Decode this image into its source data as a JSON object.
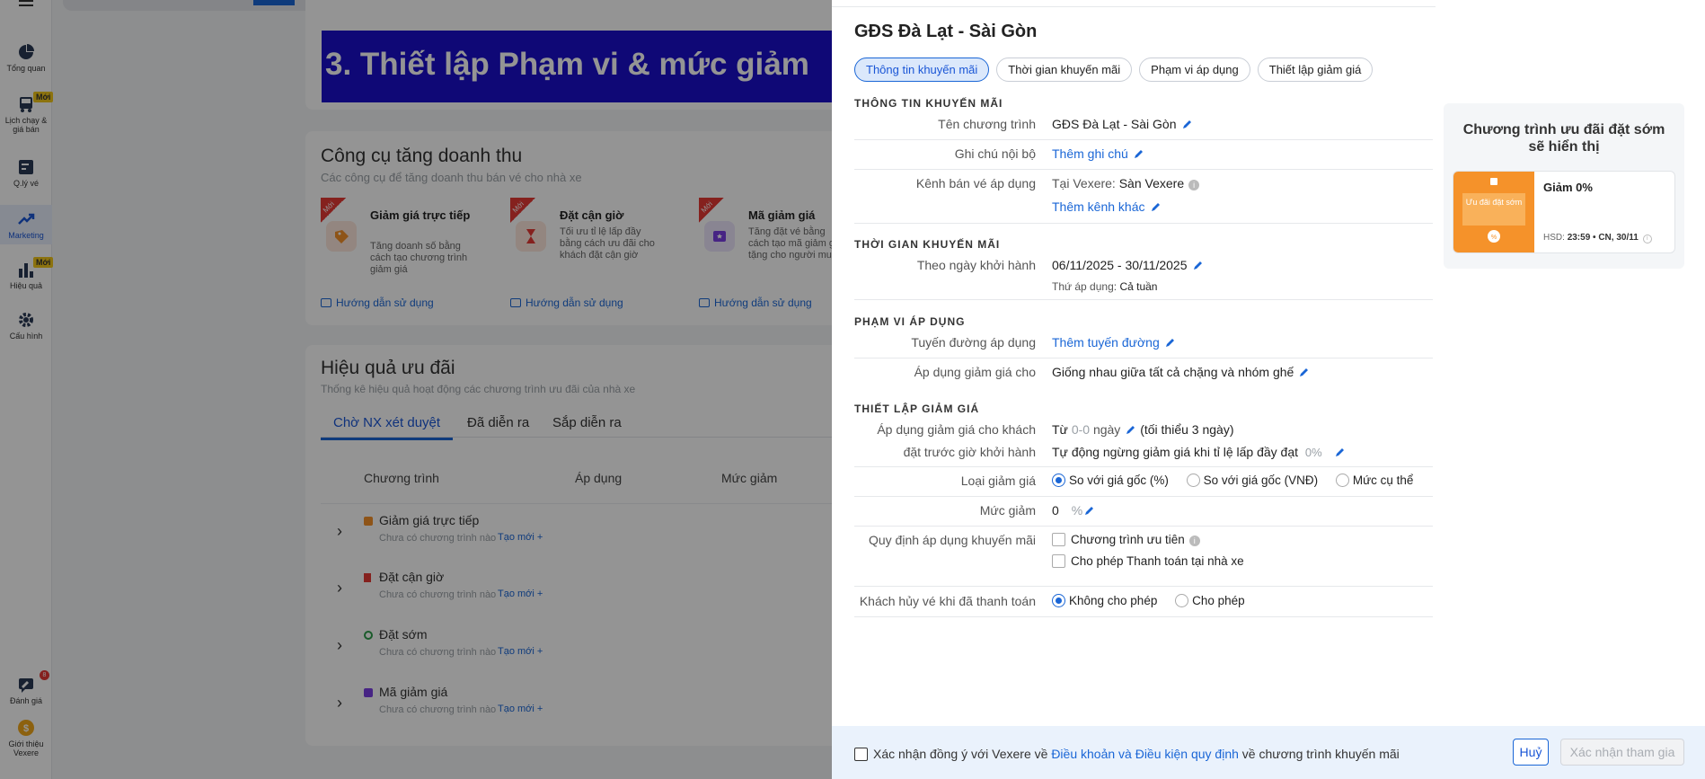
{
  "sidebar": {
    "items": [
      {
        "label": "Tổng quan",
        "icon": "pie-chart-icon"
      },
      {
        "label": "Lịch chạy & giá bán",
        "icon": "bus-icon",
        "badge": "Mới"
      },
      {
        "label": "Q.lý vé",
        "icon": "ticket-list-icon"
      },
      {
        "label": "Marketing",
        "icon": "trend-icon",
        "active": true
      },
      {
        "label": "Hiệu quả",
        "icon": "bar-chart-icon",
        "badge": "Mới"
      },
      {
        "label": "Cấu hình",
        "icon": "gear-icon"
      },
      {
        "label": "Đánh giá",
        "icon": "review-icon",
        "count": "8"
      },
      {
        "label": "Giới thiệu Vexere",
        "icon": "coin-icon"
      }
    ]
  },
  "banner": {
    "text": "3. Thiết lập Phạm vi & mức giảm"
  },
  "revenue_tools": {
    "title": "Công cụ tăng doanh thu",
    "subtitle": "Các công cụ để tăng doanh thu bán vé cho nhà xe",
    "ribbon": "Mới",
    "guide": "Hướng dẫn sử dụng",
    "tools": [
      {
        "title": "Giảm giá trực tiếp",
        "desc": "Tăng doanh số bằng cách tạo chương trình giảm giá"
      },
      {
        "title": "Đặt cận giờ",
        "desc": "Tối ưu tỉ lệ lấp đầy bằng cách ưu đãi cho khách đặt cận giờ"
      },
      {
        "title": "Mã giảm giá",
        "desc": "Tăng đặt vé bằng cách tạo mã giảm giá tặng cho người mua"
      }
    ]
  },
  "effectiveness": {
    "title": "Hiệu quả ưu đãi",
    "subtitle": "Thống kê hiệu quả hoạt động các chương trình ưu đãi của nhà xe",
    "tabs": [
      "Chờ NX xét duyệt",
      "Đã diễn ra",
      "Sắp diễn ra"
    ],
    "columns": [
      "Chương trình",
      "Áp dụng",
      "Mức giảm"
    ],
    "empty": "Chưa có chương trình nào",
    "create": "Tạo mới +",
    "rows": [
      "Giảm giá trực tiếp",
      "Đặt cận giờ",
      "Đặt sớm",
      "Mã giảm giá"
    ]
  },
  "panel": {
    "title": "GĐS Đà Lạt - Sài Gòn",
    "chips": [
      "Thông tin khuyến mãi",
      "Thời gian khuyến mãi",
      "Phạm vi áp dụng",
      "Thiết lập giảm giá"
    ],
    "sec_info": "THÔNG TIN KHUYẾN MÃI",
    "program_name_label": "Tên chương trình",
    "program_name": "GĐS Đà Lạt - Sài Gòn",
    "note_label": "Ghi chú nội bộ",
    "note_add": "Thêm ghi chú",
    "channel_label": "Kênh bán vé áp dụng",
    "channel_prefix": "Tại Vexere:",
    "channel_value": "Sàn Vexere",
    "channel_add": "Thêm kênh khác",
    "sec_time": "THỜI GIAN KHUYẾN MÃI",
    "date_label": "Theo ngày khởi hành",
    "date_value": "06/11/2025 - 30/11/2025",
    "weekday_label": "Thứ áp dụng:",
    "weekday_value": "Cả tuần",
    "sec_scope": "PHẠM VI ÁP DỤNG",
    "route_label": "Tuyến đường áp dụng",
    "route_add": "Thêm tuyến đường",
    "apply_label": "Áp dụng giảm giá cho",
    "apply_value": "Giống nhau giữa tất cả chặng và nhóm ghế",
    "sec_discount": "THIẾT LẬP GIẢM GIÁ",
    "early_label_1": "Áp dụng giảm giá cho khách",
    "early_label_2": "đặt trước giờ khởi hành",
    "early_from": "Từ",
    "early_range": "0-0",
    "early_unit": "ngày",
    "early_min": "(tối thiểu 3 ngày)",
    "auto_stop": "Tự động ngừng giảm giá khi tỉ lệ lấp đầy đạt",
    "auto_stop_value": "0%",
    "type_label": "Loại giảm giá",
    "type_options": [
      "So với giá gốc (%)",
      "So với giá gốc (VNĐ)",
      "Mức cụ thể"
    ],
    "level_label": "Mức giảm",
    "level_value": "0",
    "level_unit": "%",
    "rules_label": "Quy định áp dụng khuyến mãi",
    "rule_priority": "Chương trình ưu tiên",
    "rule_pay": "Cho phép Thanh toán tại nhà xe",
    "cancel_label": "Khách hủy vé khi đã thanh toán",
    "cancel_options": [
      "Không cho phép",
      "Cho phép"
    ]
  },
  "preview": {
    "title": "Chương trình ưu đãi đặt sớm sẽ hiển thị",
    "tag": "Ưu đãi đặt sớm",
    "discount": "Giảm 0%",
    "hsd_label": "HSD:",
    "hsd_value": "23:59 • CN, 30/11"
  },
  "footer": {
    "agree_prefix": "Xác nhận đồng ý với Vexere về",
    "agree_link": "Điều khoản và Điều kiện quy định",
    "agree_suffix": "về chương trình khuyến mãi",
    "cancel": "Huỷ",
    "confirm": "Xác nhận tham gia"
  },
  "colors": {
    "accent": "#1a66d6",
    "banner": "#1a0fcc",
    "orange": "#f5922a",
    "badge": "#f2c61a"
  }
}
